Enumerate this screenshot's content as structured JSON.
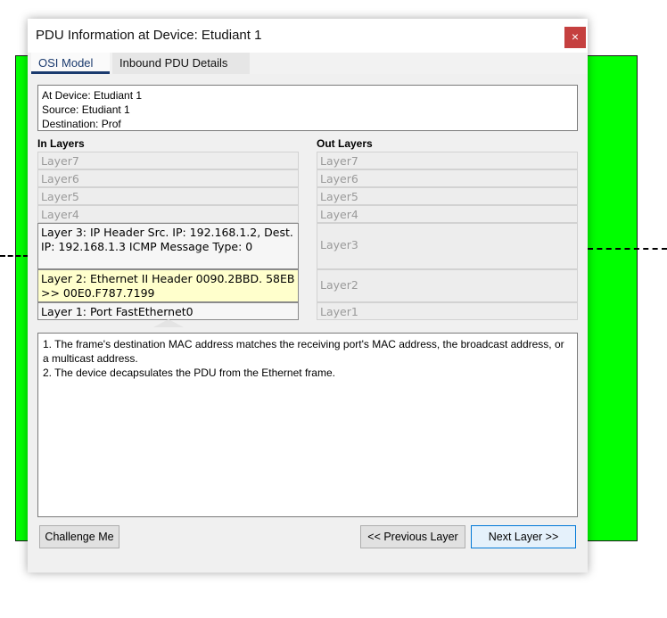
{
  "dialog": {
    "title": "PDU Information at Device: Etudiant 1",
    "close_glyph": "×"
  },
  "tabs": [
    {
      "label": "OSI Model",
      "selected": true
    },
    {
      "label": "Inbound PDU Details",
      "selected": false
    }
  ],
  "info": {
    "device": "At Device: Etudiant 1",
    "source": "Source: Etudiant 1",
    "destination": "Destination: Prof"
  },
  "in_layers": {
    "heading": "In Layers",
    "items": [
      {
        "label": "Layer7",
        "state": "disabled"
      },
      {
        "label": "Layer6",
        "state": "disabled"
      },
      {
        "label": "Layer5",
        "state": "disabled"
      },
      {
        "label": "Layer4",
        "state": "disabled"
      },
      {
        "label": "Layer 3: IP Header Src. IP: 192.168.1.2, Dest. IP: 192.168.1.3 ICMP Message Type: 0",
        "state": "active"
      },
      {
        "label": "Layer 2: Ethernet II Header 0090.2BBD. 58EB >> 00E0.F787.7199",
        "state": "selected"
      },
      {
        "label": "Layer 1: Port FastEthernet0",
        "state": "active"
      }
    ]
  },
  "out_layers": {
    "heading": "Out Layers",
    "items": [
      {
        "label": "Layer7",
        "state": "disabled"
      },
      {
        "label": "Layer6",
        "state": "disabled"
      },
      {
        "label": "Layer5",
        "state": "disabled"
      },
      {
        "label": "Layer4",
        "state": "disabled"
      },
      {
        "label": "Layer3",
        "state": "disabled"
      },
      {
        "label": "Layer2",
        "state": "disabled"
      },
      {
        "label": "Layer1",
        "state": "disabled"
      }
    ]
  },
  "description": {
    "line1": "1. The frame's destination MAC address matches the receiving port's MAC address, the broadcast address, or a multicast address.",
    "line2": "2. The device decapsulates the PDU from the Ethernet frame."
  },
  "buttons": {
    "challenge": "Challenge Me",
    "previous": "<< Previous Layer",
    "next": "Next Layer >>"
  },
  "colors": {
    "workspace_green": "#00ff00",
    "selected_layer": "#ffffcc",
    "close_button": "#c5403f",
    "tab_accent": "#1a3a6e"
  }
}
